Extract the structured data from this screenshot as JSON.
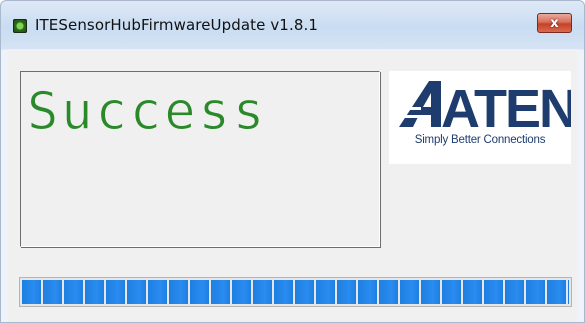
{
  "window": {
    "title": "ITESensorHubFirmwareUpdate v1.8.1",
    "close_label": "x"
  },
  "status": {
    "text": "Success",
    "color": "#2a8a2a"
  },
  "logo": {
    "brand": "ATEN",
    "tagline": "Simply Better Connections",
    "color": "#1f3c6e"
  },
  "progress": {
    "fraction": 1.0,
    "color": "#1e7fe0"
  },
  "icons": {
    "app": "app-chip-icon",
    "close": "close-icon"
  }
}
